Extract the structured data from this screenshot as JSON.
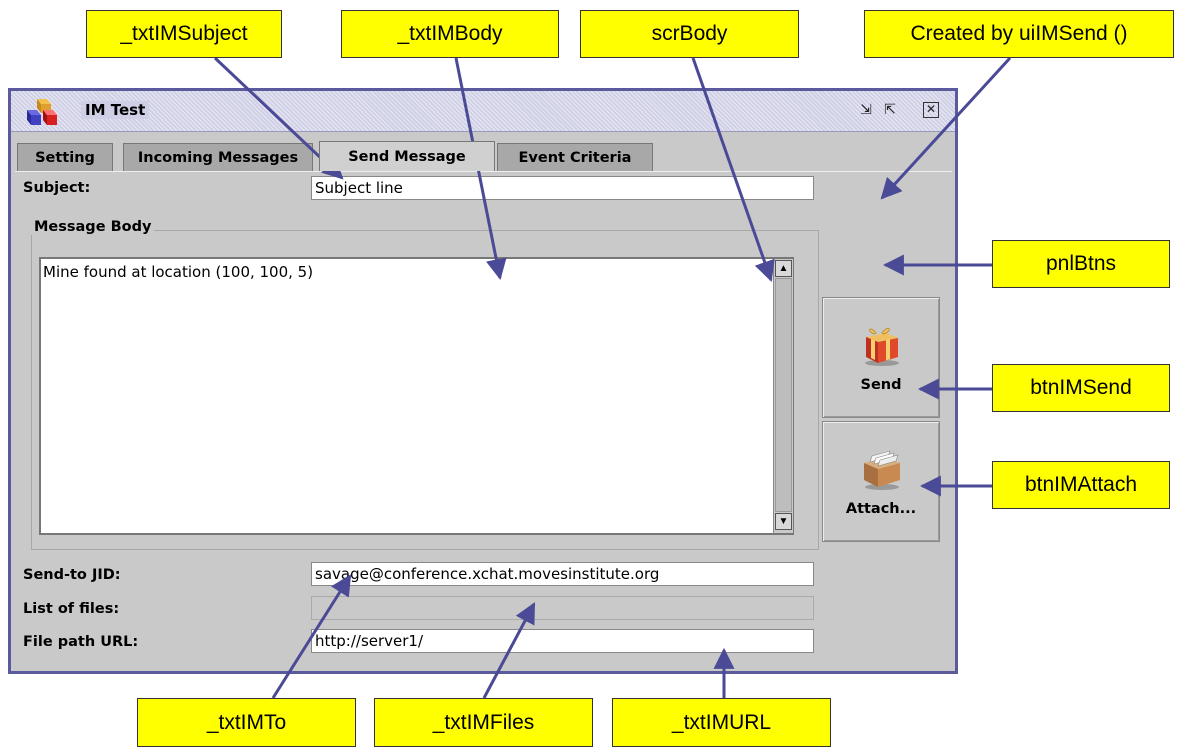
{
  "window": {
    "title": "IM Test",
    "controls": [
      "minimize-icon",
      "maximize-icon",
      "close-icon"
    ]
  },
  "tabs": [
    {
      "label": "Setting",
      "active": false
    },
    {
      "label": "Incoming Messages",
      "active": false
    },
    {
      "label": "Send Message",
      "active": true
    },
    {
      "label": "Event Criteria",
      "active": false
    }
  ],
  "form": {
    "subject_label": "Subject:",
    "subject_value": "Subject line",
    "body_group_title": "Message Body",
    "body_text": "Mine found at location (100, 100, 5)",
    "jid_label": "Send-to JID:",
    "jid_value": "savage@conference.xchat.movesinstitute.org",
    "files_label": "List of files:",
    "files_value": "",
    "url_label": "File path URL:",
    "url_value": "http://server1/"
  },
  "buttons": {
    "send_label": "Send",
    "attach_label": "Attach..."
  },
  "callouts": {
    "txt_subject": "_txtIMSubject",
    "txt_body": "_txtIMBody",
    "scr_body": "scrBody",
    "created_by": "Created by uiIMSend ()",
    "pnl_btns": "pnlBtns",
    "btn_send": "btnIMSend",
    "btn_attach": "btnIMAttach",
    "txt_to": "_txtIMTo",
    "txt_files": "_txtIMFiles",
    "txt_url": "_txtIMURL"
  },
  "colors": {
    "callout_bg": "#ffff00",
    "arrow": "#4a4a96",
    "window_border": "#5a5a9c",
    "panel_bg": "#c9c9c9"
  }
}
